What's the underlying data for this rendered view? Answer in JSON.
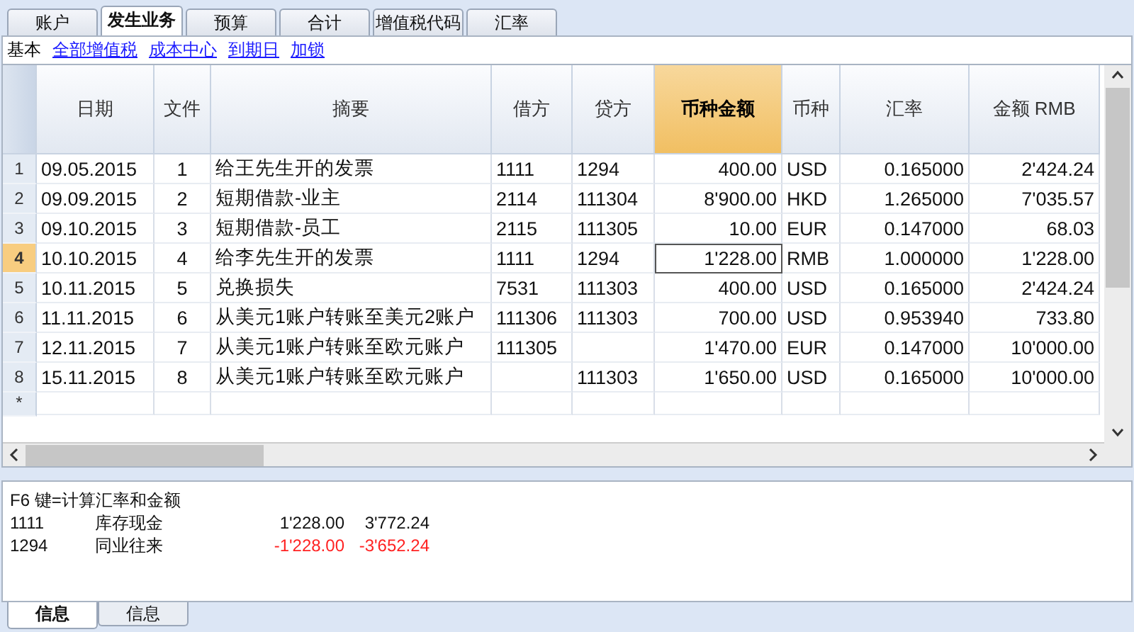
{
  "tabs": [
    {
      "label": "账户",
      "selected": false
    },
    {
      "label": "发生业务",
      "selected": true
    },
    {
      "label": "预算",
      "selected": false
    },
    {
      "label": "合计",
      "selected": false
    },
    {
      "label": "增值税代码",
      "selected": false
    },
    {
      "label": "汇率",
      "selected": false
    }
  ],
  "views": [
    {
      "label": "基本",
      "selected": true
    },
    {
      "label": "全部增值税",
      "selected": false
    },
    {
      "label": "成本中心",
      "selected": false
    },
    {
      "label": "到期日",
      "selected": false
    },
    {
      "label": "加锁",
      "selected": false
    }
  ],
  "table": {
    "columns": [
      {
        "label": "日期",
        "selected": false
      },
      {
        "label": "文件",
        "selected": false
      },
      {
        "label": "摘要",
        "selected": false
      },
      {
        "label": "借方",
        "selected": false
      },
      {
        "label": "贷方",
        "selected": false
      },
      {
        "label": "币种金额",
        "selected": true
      },
      {
        "label": "币种",
        "selected": false
      },
      {
        "label": "汇率",
        "selected": false
      },
      {
        "label": "金额 RMB",
        "selected": false
      }
    ],
    "rows": [
      {
        "number": "1",
        "selected": false,
        "cells": [
          "09.05.2015",
          "1",
          "给王先生开的发票",
          "1111",
          "1294",
          "400.00",
          "USD",
          "0.165000",
          "2'424.24"
        ]
      },
      {
        "number": "2",
        "selected": false,
        "cells": [
          "09.09.2015",
          "2",
          "短期借款-业主",
          "2114",
          "111304",
          "8'900.00",
          "HKD",
          "1.265000",
          "7'035.57"
        ]
      },
      {
        "number": "3",
        "selected": false,
        "cells": [
          "09.10.2015",
          "3",
          "短期借款-员工",
          "2115",
          "111305",
          "10.00",
          "EUR",
          "0.147000",
          "68.03"
        ]
      },
      {
        "number": "4",
        "selected": true,
        "cells": [
          "10.10.2015",
          "4",
          "给李先生开的发票",
          "1111",
          "1294",
          "1'228.00",
          "RMB",
          "1.000000",
          "1'228.00"
        ]
      },
      {
        "number": "5",
        "selected": false,
        "cells": [
          "10.11.2015",
          "5",
          "兑换损失",
          "7531",
          "111303",
          "400.00",
          "USD",
          "0.165000",
          "2'424.24"
        ]
      },
      {
        "number": "6",
        "selected": false,
        "cells": [
          "11.11.2015",
          "6",
          "从美元1账户转账至美元2账户",
          "111306",
          "111303",
          "700.00",
          "USD",
          "0.953940",
          "733.80"
        ]
      },
      {
        "number": "7",
        "selected": false,
        "cells": [
          "12.11.2015",
          "7",
          "从美元1账户转账至欧元账户",
          "111305",
          "",
          "1'470.00",
          "EUR",
          "0.147000",
          "10'000.00"
        ]
      },
      {
        "number": "8",
        "selected": false,
        "cells": [
          "15.11.2015",
          "8",
          "从美元1账户转账至欧元账户",
          "",
          "111303",
          "1'650.00",
          "USD",
          "0.165000",
          "10'000.00"
        ]
      }
    ],
    "new_row_marker": "*"
  },
  "info": {
    "message": "F6 键=计算汇率和金额",
    "entries": [
      {
        "account": "1111",
        "name": "库存现金",
        "amount": "1'228.00",
        "balance": "3'772.24",
        "negative": false
      },
      {
        "account": "1294",
        "name": "同业往来",
        "amount": "-1'228.00",
        "balance": "-3'652.24",
        "negative": true
      }
    ]
  },
  "bottom_tabs": [
    {
      "label": "信息",
      "selected": true
    },
    {
      "label": "信息",
      "selected": false
    }
  ]
}
